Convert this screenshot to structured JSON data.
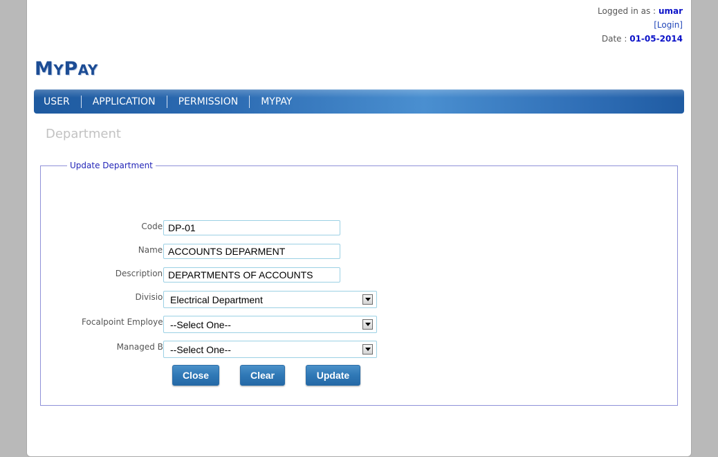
{
  "header": {
    "logged_in_label": "Logged in as :",
    "username": "umar",
    "login_link": "[Login]",
    "date_label": "Date :",
    "date_value": "01-05-2014"
  },
  "logo": {
    "part1_big": "M",
    "part1_small": "Y",
    "part2_big": "P",
    "part2_small": "AY"
  },
  "nav": {
    "items": [
      "USER",
      "APPLICATION",
      "PERMISSION",
      "MYPAY"
    ]
  },
  "page": {
    "title": "Department"
  },
  "form": {
    "legend": "Update Department",
    "code_label": "Code :",
    "code_value": "DP-01",
    "name_label": "Name :",
    "name_value": "ACCOUNTS DEPARMENT",
    "description_label": "Description :",
    "description_value": "DEPARTMENTS OF ACCOUNTS",
    "division_label": "Division",
    "division_value": "Electrical Department",
    "focalpoint_label": "Focalpoint Employee",
    "focalpoint_value": "--Select One--",
    "managed_label": "Managed By",
    "managed_value": "--Select One--",
    "close_label": "Close",
    "clear_label": "Clear",
    "update_label": "Update"
  },
  "colors": {
    "accent": "#0b12c8",
    "nav_blue": "#2d6cb3",
    "button_blue": "#2f78b6",
    "legend_border": "#8e90d8"
  }
}
